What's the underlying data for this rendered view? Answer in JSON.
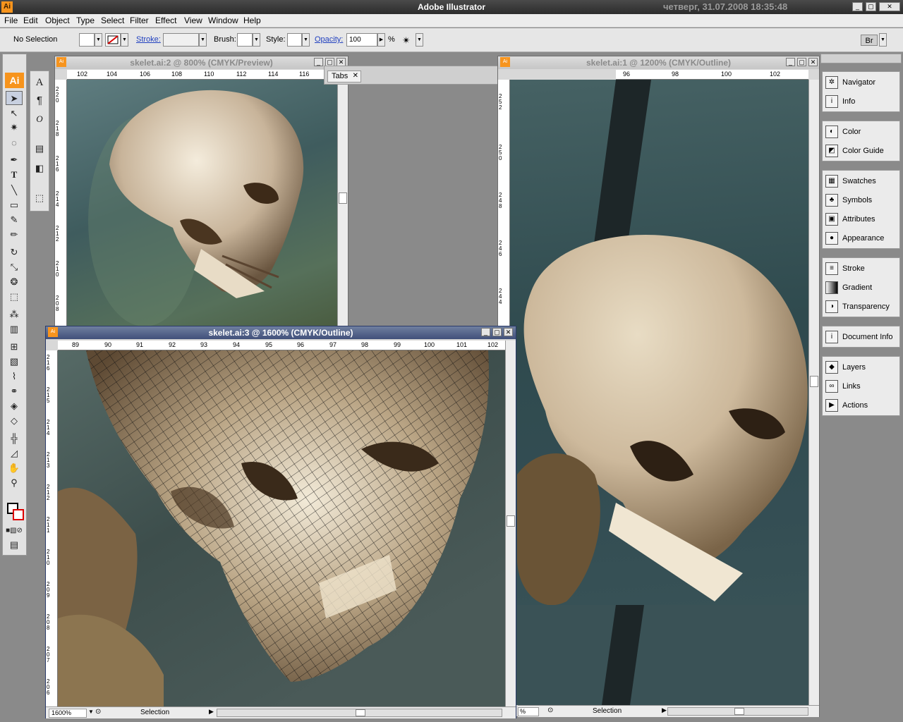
{
  "app": {
    "title": "Adobe Illustrator",
    "logo": "Ai",
    "clock": "четверг, 31.07.2008 18:35:48"
  },
  "menu": [
    "File",
    "Edit",
    "Object",
    "Type",
    "Select",
    "Filter",
    "Effect",
    "View",
    "Window",
    "Help"
  ],
  "controlbar": {
    "selection": "No Selection",
    "stroke_label": "Stroke:",
    "brush_label": "Brush:",
    "style_label": "Style:",
    "opacity_label": "Opacity:",
    "opacity_value": "100",
    "percent": "%"
  },
  "tools": {
    "logo": "Ai",
    "icons": [
      "selection-tool-icon",
      "direct-selection-tool-icon",
      "magic-wand-icon",
      "lasso-icon",
      "pen-tool-icon",
      "type-tool-icon",
      "line-tool-icon",
      "rectangle-tool-icon",
      "paintbrush-icon",
      "pencil-icon",
      "rotate-tool-icon",
      "scale-tool-icon",
      "warp-tool-icon",
      "free-transform-icon",
      "symbol-sprayer-icon",
      "graph-tool-icon",
      "mesh-tool-icon",
      "gradient-tool-icon",
      "eyedropper-icon",
      "blend-tool-icon",
      "live-paint-icon",
      "live-paint-selection-icon",
      "slice-tool-icon",
      "eraser-icon",
      "hand-tool-icon",
      "zoom-tool-icon"
    ]
  },
  "windows": {
    "doc2": {
      "title": "skelet.ai:2 @ 800% (CMYK/Preview)",
      "hruler": [
        "102",
        "104",
        "106",
        "108",
        "110",
        "112",
        "114",
        "116"
      ],
      "vruler": [
        "220",
        "218",
        "216",
        "214",
        "212",
        "210",
        "208"
      ]
    },
    "doc1": {
      "title": "skelet.ai:1 @ 1200% (CMYK/Outline)",
      "hruler": [
        "96",
        "98",
        "100",
        "102"
      ],
      "vruler": [
        "252",
        "250",
        "248",
        "246",
        "244"
      ],
      "status_zoom": "%",
      "status_tool": "Selection"
    },
    "doc3": {
      "title": "skelet.ai:3 @ 1600% (CMYK/Outline)",
      "hruler": [
        "89",
        "90",
        "91",
        "92",
        "93",
        "94",
        "95",
        "96",
        "97",
        "98",
        "99",
        "100",
        "101",
        "102"
      ],
      "vruler": [
        "216",
        "215",
        "214",
        "213",
        "212",
        "211",
        "210",
        "209",
        "208",
        "207",
        "206"
      ],
      "status_zoom": "1600%",
      "status_tool": "Selection"
    }
  },
  "tabs_panel": {
    "label": "Tabs"
  },
  "panels": [
    {
      "group": 1,
      "items": [
        {
          "label": "Navigator",
          "icon": "navigator-icon"
        },
        {
          "label": "Info",
          "icon": "info-icon"
        }
      ]
    },
    {
      "group": 2,
      "items": [
        {
          "label": "Color",
          "icon": "color-icon"
        },
        {
          "label": "Color Guide",
          "icon": "color-guide-icon"
        }
      ]
    },
    {
      "group": 3,
      "items": [
        {
          "label": "Swatches",
          "icon": "swatches-icon"
        },
        {
          "label": "Symbols",
          "icon": "symbols-icon"
        },
        {
          "label": "Attributes",
          "icon": "attributes-icon"
        },
        {
          "label": "Appearance",
          "icon": "appearance-icon"
        }
      ]
    },
    {
      "group": 4,
      "items": [
        {
          "label": "Stroke",
          "icon": "stroke-icon"
        },
        {
          "label": "Gradient",
          "icon": "gradient-icon"
        },
        {
          "label": "Transparency",
          "icon": "transparency-icon"
        }
      ]
    },
    {
      "group": 5,
      "items": [
        {
          "label": "Document Info",
          "icon": "document-info-icon"
        }
      ]
    },
    {
      "group": 6,
      "items": [
        {
          "label": "Layers",
          "icon": "layers-icon"
        },
        {
          "label": "Links",
          "icon": "links-icon"
        },
        {
          "label": "Actions",
          "icon": "actions-icon"
        }
      ]
    }
  ]
}
